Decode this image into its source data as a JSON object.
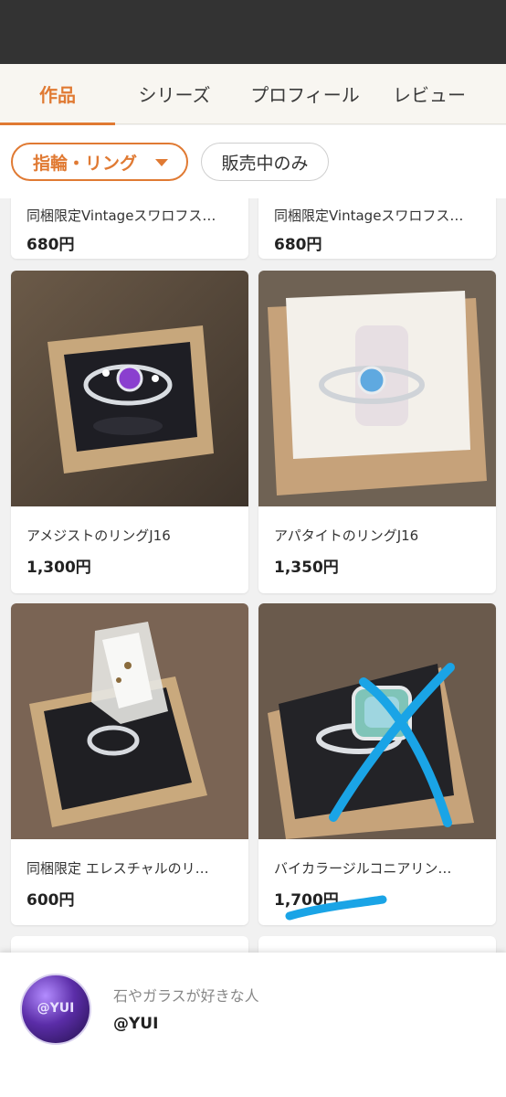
{
  "tabs": [
    {
      "label": "作品"
    },
    {
      "label": "シリーズ"
    },
    {
      "label": "プロフィール"
    },
    {
      "label": "レビュー"
    }
  ],
  "filters": {
    "category_label": "指輪・リング",
    "sale_only_label": "販売中のみ"
  },
  "items": [
    {
      "title": "同梱限定Vintageスワロフス…",
      "price": "680円"
    },
    {
      "title": "同梱限定Vintageスワロフス…",
      "price": "680円"
    },
    {
      "title": "アメジストのリングJ16",
      "price": "1,300円"
    },
    {
      "title": "アパタイトのリングJ16",
      "price": "1,350円"
    },
    {
      "title": "同梱限定 エレスチャルのリ…",
      "price": "600円"
    },
    {
      "title": "バイカラージルコニアリン…",
      "price": "1,700円"
    }
  ],
  "profile": {
    "avatar_text": "@YUI",
    "bio": "石やガラスが好きな人",
    "handle": "@YUI"
  },
  "colors": {
    "accent": "#e07a33",
    "status_bar": "#333333",
    "annotation": "#1aa4e6"
  }
}
